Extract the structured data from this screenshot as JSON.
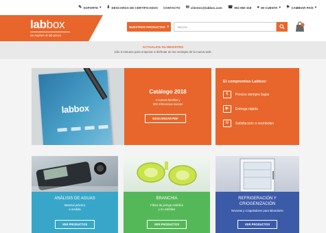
{
  "topbar": {
    "soporte": "SOPORTE",
    "certificados": "DESCARGA DE CERTIFICADOS",
    "contacto": "CONTACTO",
    "email": "clientes@labbox.com",
    "phone": "902 950 318",
    "cuenta": "MI CUENTA",
    "pais": "CAMBIAR PAÍS"
  },
  "header": {
    "logo_bold": "lab",
    "logo_thin": "box",
    "tagline": "we explore at lab prices",
    "products_button": "NUESTROS PRODUCTOS",
    "search_placeholder": "Buscar..."
  },
  "banner": {
    "line1": "ACTUALICE SU REGISTRO",
    "line2": "sólo 3 minutos para empezar a disfrutar de las ventajas de la nueva web."
  },
  "catalog": {
    "image_logo": "labbox",
    "title": "Catálogo 2018",
    "sub1": "3 nuevas familias y",
    "sub2": "500 referencias nuevas",
    "button": "DESCARGAR PDF"
  },
  "compromisos": {
    "title": "El compromiso Labbox:",
    "items": [
      {
        "label": "Precios siempre bajos",
        "icon": "euro-icon",
        "glyph": "€"
      },
      {
        "label": "Entrega rápida",
        "icon": "truck-icon",
        "glyph": "▶"
      },
      {
        "label": "Satisfacción o reembolso",
        "icon": "money-icon",
        "glyph": "≋"
      }
    ]
  },
  "tiles": [
    {
      "title": "ANÁLISIS DE AGUAS",
      "sub1": "Material práctico",
      "sub2": "a medida",
      "button": "VER PRODUCTOS",
      "color": "#38a6c9"
    },
    {
      "title": "BRANCHIA",
      "sub1": "Filtros de jeringa estériles",
      "sub2": "y no estériles",
      "button": "VER PRODUCTOS",
      "color": "#55b858"
    },
    {
      "title1": "REFRIGERACIÓN Y",
      "title2": "CRIOGENIZACIÓN",
      "sub1": "Neveras y congeladores para laboratorio",
      "button": "VER PRODUCTOS",
      "color": "#3b5aa8"
    }
  ],
  "colors": {
    "brand": "#e8662b",
    "water": "#38a6c9",
    "branchia": "#55b858",
    "refrig": "#3b5aa8"
  }
}
